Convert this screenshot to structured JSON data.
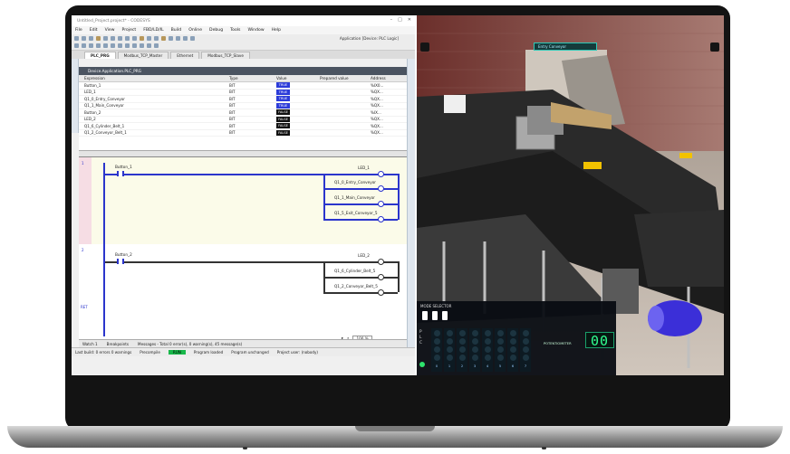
{
  "ide": {
    "title": "Untitled_Project.project* - CODESYS",
    "window_controls": [
      "–",
      "□",
      "✕"
    ],
    "menu": [
      "File",
      "Edit",
      "View",
      "Project",
      "FBD/LD/IL",
      "Build",
      "Online",
      "Debug",
      "Tools",
      "Window",
      "Help"
    ],
    "application_label": "Application [Device: PLC Logic]",
    "tabs": [
      "PLC_PRG",
      "Modbus_TCP_Master",
      "Ethernet",
      "Modbus_TCP_Slave"
    ],
    "path": "Device.Application.PLC_PRG",
    "watch_headers": [
      "Expression",
      "Type",
      "Value",
      "Prepared value",
      "Address"
    ],
    "watch_rows": [
      {
        "exp": "Button_1",
        "type": "BIT",
        "value": "TRUE",
        "addr": "%IX0..."
      },
      {
        "exp": "LED_1",
        "type": "BIT",
        "value": "TRUE",
        "addr": "%QX..."
      },
      {
        "exp": "Q1_0_Entry_Conveyor",
        "type": "BIT",
        "value": "TRUE",
        "addr": "%QX..."
      },
      {
        "exp": "Q1_1_Main_Conveyor",
        "type": "BIT",
        "value": "TRUE",
        "addr": "%QX..."
      },
      {
        "exp": "Button_2",
        "type": "BIT",
        "value": "FALSE",
        "addr": "%IX..."
      },
      {
        "exp": "LED_2",
        "type": "BIT",
        "value": "FALSE",
        "addr": "%QX..."
      },
      {
        "exp": "Q1_6_Cylinder_Belt_1",
        "type": "BIT",
        "value": "FALSE",
        "addr": "%QX..."
      },
      {
        "exp": "Q1_2_Conveyor_Belt_1",
        "type": "BIT",
        "value": "FALSE",
        "addr": "%QX..."
      }
    ],
    "ladder": {
      "net1_no": "1",
      "net2_no": "2",
      "net3_no": "RET",
      "r1_contact": "Button_1",
      "r1_coils": [
        "LED_1",
        "Q1_0_Entry_Conveyor",
        "Q1_1_Main_Conveyor",
        "Q1_5_Exit_Conveyor_5"
      ],
      "r2_contact": "Button_2",
      "r2_coils": [
        "LED_2",
        "Q1_6_Cylinder_Belt_5",
        "Q1_2_Conveyor_Belt_5"
      ]
    },
    "zoom": "100 %",
    "bottom_tabs": [
      "Watch 1",
      "Breakpoints",
      "Messages - Total 0 error(s), 0 warning(s), 45 message(s)"
    ],
    "status": {
      "user": "Last build: 0 errors 0 warnings",
      "precompile": "Precompile",
      "run": "RUN",
      "program_loaded": "Program loaded",
      "unchanged": "Program unchanged",
      "project_user": "Project user: (nobody)"
    }
  },
  "sim": {
    "tag": "Entry Conveyor",
    "panel_title": "MODE SELECTOR",
    "plc": [
      "P",
      "L",
      "C"
    ],
    "channels": [
      "0",
      "1",
      "2",
      "3",
      "4",
      "5",
      "6",
      "7"
    ],
    "potentiometer_label": "POTENTIOMETER",
    "display": "00"
  },
  "colors": {
    "accent_blue": "#2b35cc",
    "run_green": "#18b84a",
    "seg_green": "#32ff90"
  }
}
